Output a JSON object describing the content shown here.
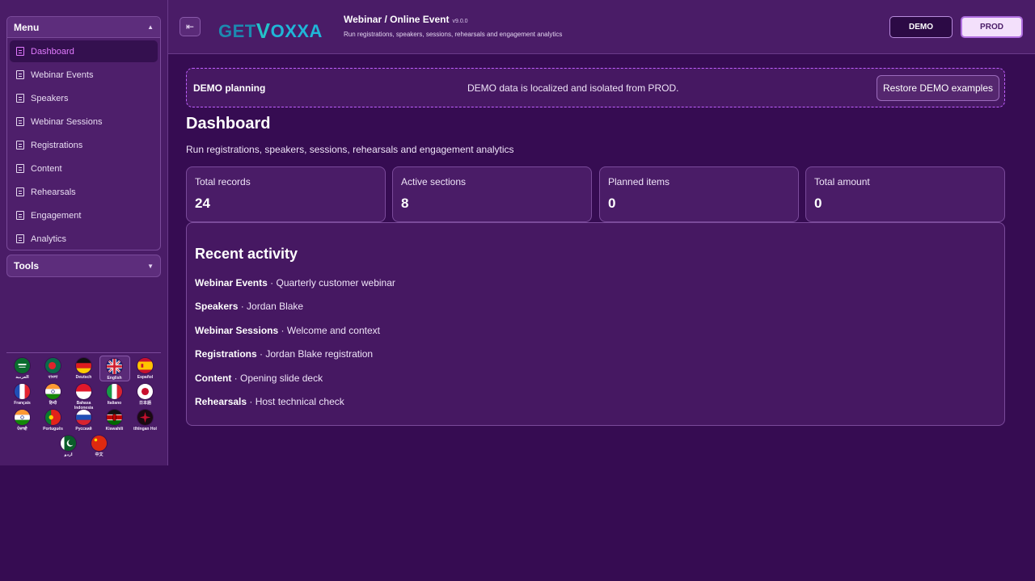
{
  "sidebar": {
    "menu_title": "Menu",
    "tools_title": "Tools",
    "items": [
      {
        "label": "Dashboard"
      },
      {
        "label": "Webinar Events"
      },
      {
        "label": "Speakers"
      },
      {
        "label": "Webinar Sessions"
      },
      {
        "label": "Registrations"
      },
      {
        "label": "Content"
      },
      {
        "label": "Rehearsals"
      },
      {
        "label": "Engagement"
      },
      {
        "label": "Analytics"
      }
    ],
    "active_item": "Dashboard",
    "languages": [
      {
        "label": "العربية",
        "flag": "sa"
      },
      {
        "label": "বাংলা",
        "flag": "bd"
      },
      {
        "label": "Deutsch",
        "flag": "de"
      },
      {
        "label": "English",
        "flag": "gb",
        "selected": true
      },
      {
        "label": "Español",
        "flag": "es"
      },
      {
        "label": "Français",
        "flag": "fr"
      },
      {
        "label": "हिन्दी",
        "flag": "in"
      },
      {
        "label": "Bahasa Indonesia",
        "flag": "id"
      },
      {
        "label": "Italiano",
        "flag": "it"
      },
      {
        "label": "日本語",
        "flag": "jp"
      },
      {
        "label": "ਪੰਜਾਬੀ",
        "flag": "in"
      },
      {
        "label": "Português",
        "flag": "pt"
      },
      {
        "label": "Русский",
        "flag": "ru"
      },
      {
        "label": "Kiswahili",
        "flag": "ke"
      },
      {
        "label": "tlhIngan Hol",
        "flag": "kl"
      },
      {
        "label": "اردو",
        "flag": "pk"
      },
      {
        "label": "中文",
        "flag": "cn"
      }
    ]
  },
  "header": {
    "logo_get": "GET",
    "logo_v": "V",
    "logo_oxxa": "OXXA",
    "title": "Webinar / Online Event",
    "version": "v9.0.0",
    "subtitle": "Run registrations, speakers, sessions, rehearsals and engagement analytics",
    "demo_label": "DEMO",
    "prod_label": "PROD"
  },
  "banner": {
    "title": "DEMO planning",
    "note": "DEMO data is localized and isolated from PROD.",
    "restore_label": "Restore DEMO examples"
  },
  "main": {
    "title": "Dashboard",
    "subtitle": "Run registrations, speakers, sessions, rehearsals and engagement analytics",
    "stats": [
      {
        "label": "Total records",
        "value": "24"
      },
      {
        "label": "Active sections",
        "value": "8"
      },
      {
        "label": "Planned items",
        "value": "0"
      },
      {
        "label": "Total amount",
        "value": "0"
      }
    ],
    "activity_title": "Recent activity",
    "activity": [
      {
        "section": "Webinar Events",
        "sep": " · ",
        "item": "Quarterly customer webinar"
      },
      {
        "section": "Speakers",
        "sep": " · ",
        "item": "Jordan Blake"
      },
      {
        "section": "Webinar Sessions",
        "sep": " · ",
        "item": "Welcome and context"
      },
      {
        "section": "Registrations",
        "sep": " · ",
        "item": "Jordan Blake registration"
      },
      {
        "section": "Content",
        "sep": " · ",
        "item": "Opening slide deck"
      },
      {
        "section": "Rehearsals",
        "sep": " · ",
        "item": "Host technical check"
      }
    ]
  },
  "colors": {
    "background": "#360c52",
    "panel": "#4a1c67",
    "accent": "#e27bff",
    "logo": "#1fb6d8"
  }
}
